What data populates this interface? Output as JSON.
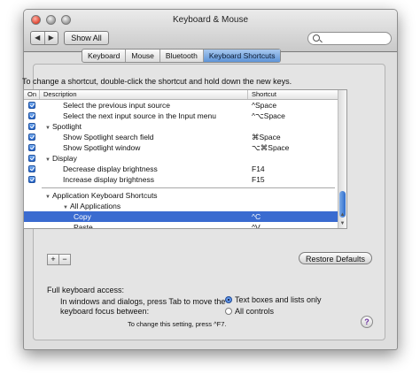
{
  "window": {
    "title": "Keyboard & Mouse",
    "show_all_label": "Show All",
    "back_glyph": "◀",
    "forward_glyph": "▶",
    "search": {
      "value": "",
      "placeholder": ""
    }
  },
  "tabs": [
    {
      "label": "Keyboard",
      "active": false
    },
    {
      "label": "Mouse",
      "active": false
    },
    {
      "label": "Bluetooth",
      "active": false
    },
    {
      "label": "Keyboard Shortcuts",
      "active": true
    }
  ],
  "instruction": "To change a shortcut, double-click the shortcut and hold down the new keys.",
  "table": {
    "headers": {
      "on": "On",
      "description": "Description",
      "shortcut": "Shortcut"
    },
    "rows": [
      {
        "type": "item",
        "checked": true,
        "level": 2,
        "description": "Select the previous input source",
        "shortcut": "^Space"
      },
      {
        "type": "item",
        "checked": true,
        "level": 2,
        "description": "Select the next input source in the Input menu",
        "shortcut": "^⌥Space"
      },
      {
        "type": "group",
        "checked": true,
        "level": 1,
        "description": "Spotlight",
        "shortcut": ""
      },
      {
        "type": "item",
        "checked": true,
        "level": 2,
        "description": "Show Spotlight search field",
        "shortcut": "⌘Space"
      },
      {
        "type": "item",
        "checked": true,
        "level": 2,
        "description": "Show Spotlight window",
        "shortcut": "⌥⌘Space"
      },
      {
        "type": "group",
        "checked": true,
        "level": 1,
        "description": "Display",
        "shortcut": ""
      },
      {
        "type": "item",
        "checked": true,
        "level": 2,
        "description": "Decrease display brightness",
        "shortcut": "F14"
      },
      {
        "type": "item",
        "checked": true,
        "level": 2,
        "description": "Increase display brightness",
        "shortcut": "F15"
      },
      {
        "type": "separator"
      },
      {
        "type": "group",
        "checked": false,
        "level": 1,
        "description": "Application Keyboard Shortcuts",
        "shortcut": ""
      },
      {
        "type": "group",
        "checked": false,
        "level": 2,
        "description": "All Applications",
        "shortcut": ""
      },
      {
        "type": "item",
        "checked": false,
        "level": 3,
        "description": "Copy",
        "shortcut": "^C",
        "selected": true
      },
      {
        "type": "item",
        "checked": false,
        "level": 3,
        "description": "Paste",
        "shortcut": "^V"
      }
    ]
  },
  "buttons": {
    "add": "+",
    "remove": "−",
    "restore_defaults": "Restore Defaults"
  },
  "full_keyboard_access": {
    "title": "Full keyboard access:",
    "description": "In windows and dialogs, press Tab to move the keyboard focus between:",
    "options": [
      {
        "label": "Text boxes and lists only",
        "selected": true
      },
      {
        "label": "All controls",
        "selected": false
      }
    ],
    "note": "To change this setting, press ^F7."
  },
  "help_label": "?",
  "colors": {
    "selection": "#3a6bd0",
    "active_tab": "#5f95d8"
  }
}
